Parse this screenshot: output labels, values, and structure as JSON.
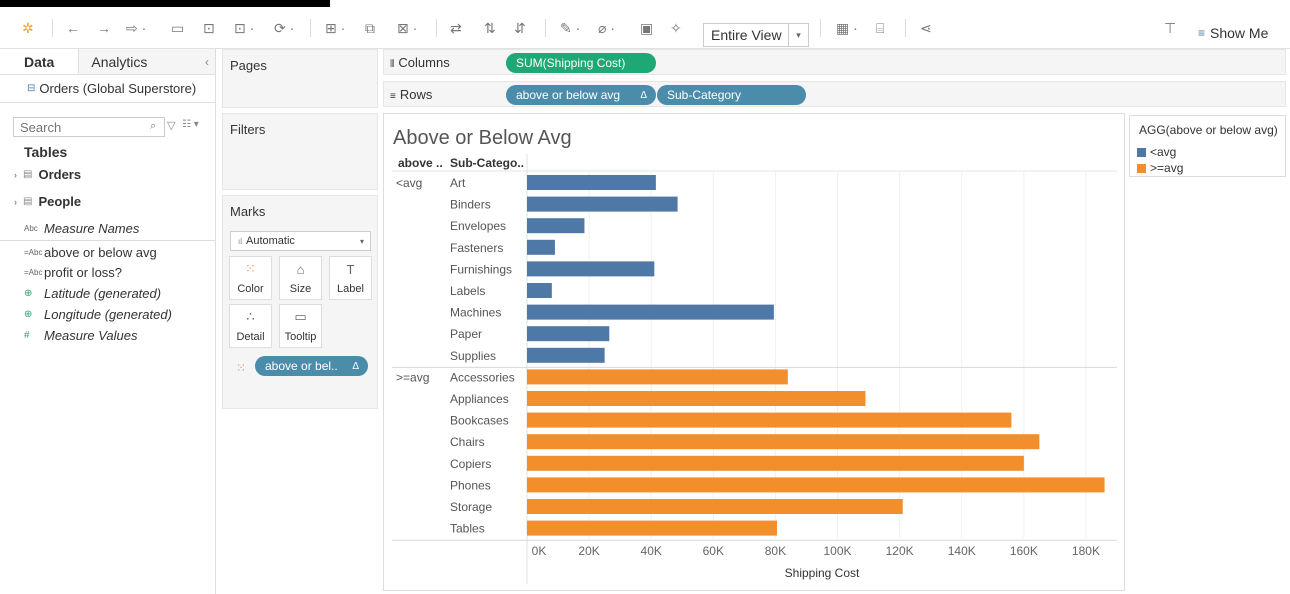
{
  "toolbar": {
    "view_mode": "Entire View",
    "show_me": "Show Me"
  },
  "data_pane": {
    "tab_data": "Data",
    "tab_analytics": "Analytics",
    "datasource": "Orders (Global Superstore)",
    "search_placeholder": "Search",
    "tables_heading": "Tables",
    "tables": [
      "Orders",
      "People"
    ],
    "fields": [
      {
        "type": "Abc",
        "name": "Measure Names",
        "italic": true
      },
      {
        "type": "=Abc",
        "name": "above or below avg",
        "italic": false
      },
      {
        "type": "=Abc",
        "name": "profit or loss?",
        "italic": false
      },
      {
        "type": "globe",
        "name": "Latitude (generated)",
        "italic": true
      },
      {
        "type": "globe",
        "name": "Longitude (generated)",
        "italic": true
      },
      {
        "type": "#",
        "name": "Measure Values",
        "italic": true
      }
    ]
  },
  "cards": {
    "pages": "Pages",
    "filters": "Filters",
    "marks": "Marks",
    "mark_type": "Automatic",
    "mark_buttons": [
      "Color",
      "Size",
      "Label",
      "Detail",
      "Tooltip"
    ],
    "color_pill": "above or bel.."
  },
  "shelves": {
    "columns_label": "Columns",
    "rows_label": "Rows",
    "columns_pill": "SUM(Shipping Cost)",
    "rows_pill_1": "above or below avg",
    "rows_pill_2": "Sub-Category"
  },
  "legend": {
    "title": "AGG(above or below avg)",
    "items": [
      {
        "label": "<avg",
        "color": "#4e79a7"
      },
      {
        "label": ">=avg",
        "color": "#f28e2b"
      }
    ]
  },
  "chart_data": {
    "type": "bar",
    "title": "Above or Below  Avg",
    "row_headers": [
      "above ..",
      "Sub-Catego.."
    ],
    "xlabel": "Shipping Cost",
    "xlim": [
      0,
      190000
    ],
    "x_ticks": [
      "0K",
      "20K",
      "40K",
      "60K",
      "80K",
      "100K",
      "120K",
      "140K",
      "160K",
      "180K"
    ],
    "groups": [
      {
        "name": "<avg",
        "color": "#4e79a7",
        "categories": [
          "Art",
          "Binders",
          "Envelopes",
          "Fasteners",
          "Furnishings",
          "Labels",
          "Machines",
          "Paper",
          "Supplies"
        ],
        "values": [
          41500,
          48500,
          18500,
          9000,
          41000,
          8000,
          79500,
          26500,
          25000
        ]
      },
      {
        "name": ">=avg",
        "color": "#f28e2b",
        "categories": [
          "Accessories",
          "Appliances",
          "Bookcases",
          "Chairs",
          "Copiers",
          "Phones",
          "Storage",
          "Tables"
        ],
        "values": [
          84000,
          109000,
          156000,
          165000,
          160000,
          186000,
          121000,
          80500
        ]
      }
    ]
  }
}
